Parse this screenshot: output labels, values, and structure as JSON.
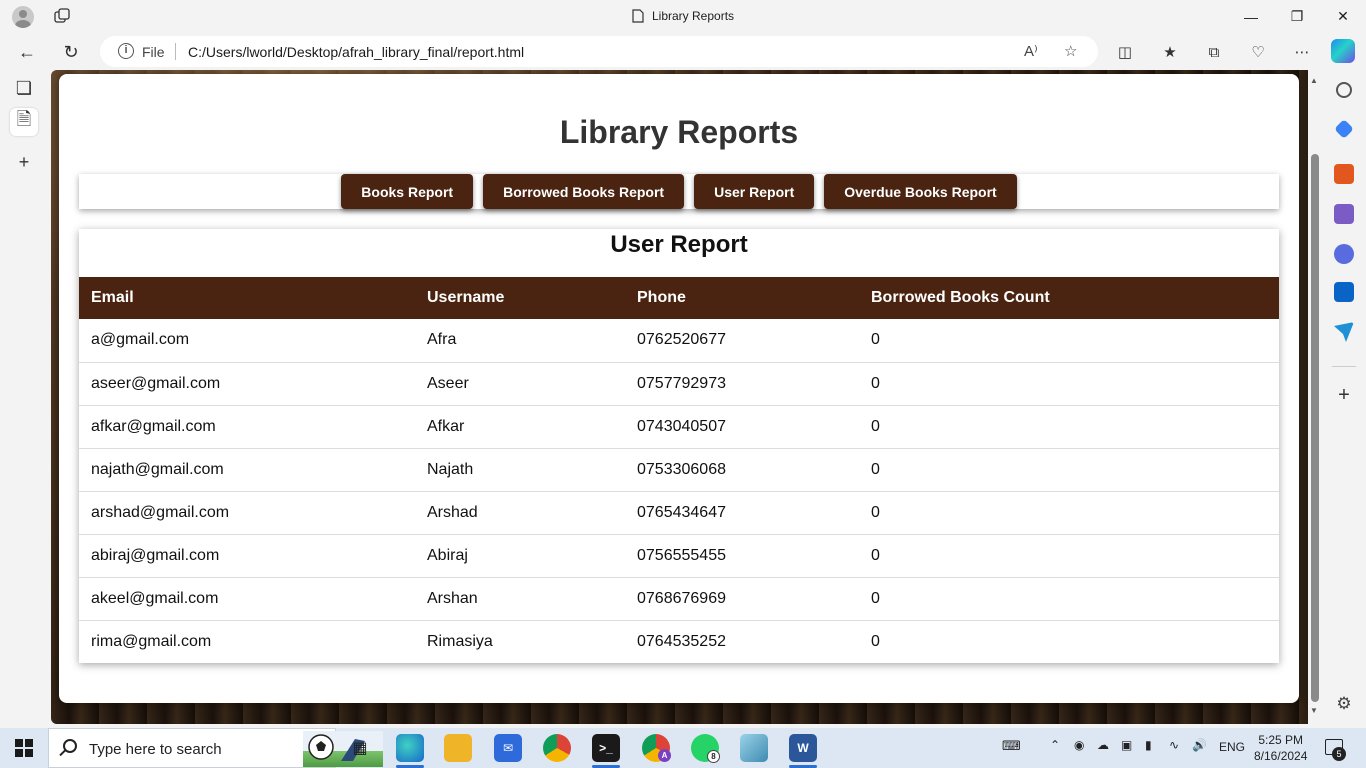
{
  "browser": {
    "tab_title": "Library Reports",
    "address_label": "File",
    "url": "C:/Users/lworld/Desktop/afrah_library_final/report.html",
    "read_aloud_glyph": "A⁾"
  },
  "page": {
    "title": "Library Reports",
    "report_buttons": [
      {
        "label": "Books Report"
      },
      {
        "label": "Borrowed Books Report"
      },
      {
        "label": "User Report"
      },
      {
        "label": "Overdue Books Report"
      }
    ],
    "report_heading": "User Report",
    "table": {
      "columns": [
        "Email",
        "Username",
        "Phone",
        "Borrowed Books Count"
      ],
      "rows": [
        [
          "a@gmail.com",
          "Afra",
          "0762520677",
          "0"
        ],
        [
          "aseer@gmail.com",
          "Aseer",
          "0757792973",
          "0"
        ],
        [
          "afkar@gmail.com",
          "Afkar",
          "0743040507",
          "0"
        ],
        [
          "najath@gmail.com",
          "Najath",
          "0753306068",
          "0"
        ],
        [
          "arshad@gmail.com",
          "Arshad",
          "0765434647",
          "0"
        ],
        [
          "abiraj@gmail.com",
          "Abiraj",
          "0756555455",
          "0"
        ],
        [
          "akeel@gmail.com",
          "Arshan",
          "0768676969",
          "0"
        ],
        [
          "rima@gmail.com",
          "Rimasiya",
          "0764535252",
          "0"
        ]
      ]
    },
    "colors": {
      "brown": "#4a2410",
      "white": "#ffffff"
    }
  },
  "taskbar": {
    "search_placeholder": "Type here to search",
    "whatsapp_badge": "8",
    "language": "ENG",
    "time": "5:25 PM",
    "date": "8/16/2024",
    "notification_count": "5",
    "word_label": "W",
    "chrome_profile_label": "A"
  }
}
